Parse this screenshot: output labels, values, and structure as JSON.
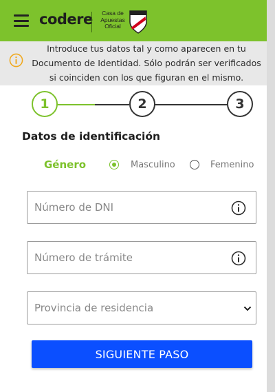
{
  "header": {
    "logo_text": "codere",
    "tagline": "Casa de Apuestas Oficial",
    "menu_icon": "hamburger-menu-icon",
    "crest_icon": "river-plate-crest-icon",
    "accent_color": "#7dc22c"
  },
  "notice": {
    "icon": "info-circle-icon",
    "text": "Introduce tus datos tal y como aparecen en tu Documento de Identidad. Sólo podrán ser verificados si coinciden con los que figuran en el mismo."
  },
  "stepper": {
    "steps": [
      "1",
      "2",
      "3"
    ],
    "active_step": 1
  },
  "form": {
    "section_title": "Datos de identificación",
    "gender": {
      "label": "Género",
      "options": [
        "Masculino",
        "Femenino"
      ],
      "selected": "Masculino"
    },
    "dni": {
      "placeholder": "Número de DNI",
      "value": "",
      "icon": "info-icon"
    },
    "tramite": {
      "placeholder": "Número de trámite",
      "value": "",
      "icon": "info-icon"
    },
    "province": {
      "placeholder": "Provincia de residencia",
      "icon": "chevron-down-icon"
    },
    "submit_label": "SIGUIENTE PASO"
  },
  "colors": {
    "brand_green": "#7dc22c",
    "button_blue": "#0b4fff",
    "notice_bg": "#e8e8e8",
    "warning_icon": "#f0a81c"
  }
}
